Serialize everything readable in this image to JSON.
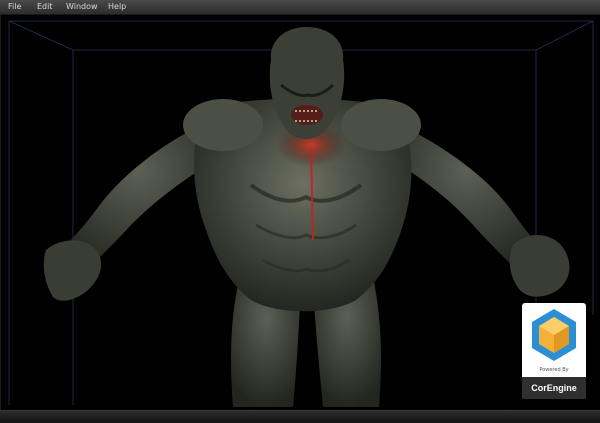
{
  "menu": [
    {
      "label": "File"
    },
    {
      "label": "Edit"
    },
    {
      "label": "Window"
    },
    {
      "label": "Help"
    }
  ],
  "viewport": {
    "background": "#000000",
    "wireframe_color": "#2b3a66",
    "model_tint": "#4a4f45",
    "blood_color": "#c0241a"
  },
  "badge": {
    "powered_by": "Powered By",
    "engine_name": "CorEngine",
    "logo_colors": [
      "#f3b13a",
      "#2a8fd4"
    ]
  }
}
